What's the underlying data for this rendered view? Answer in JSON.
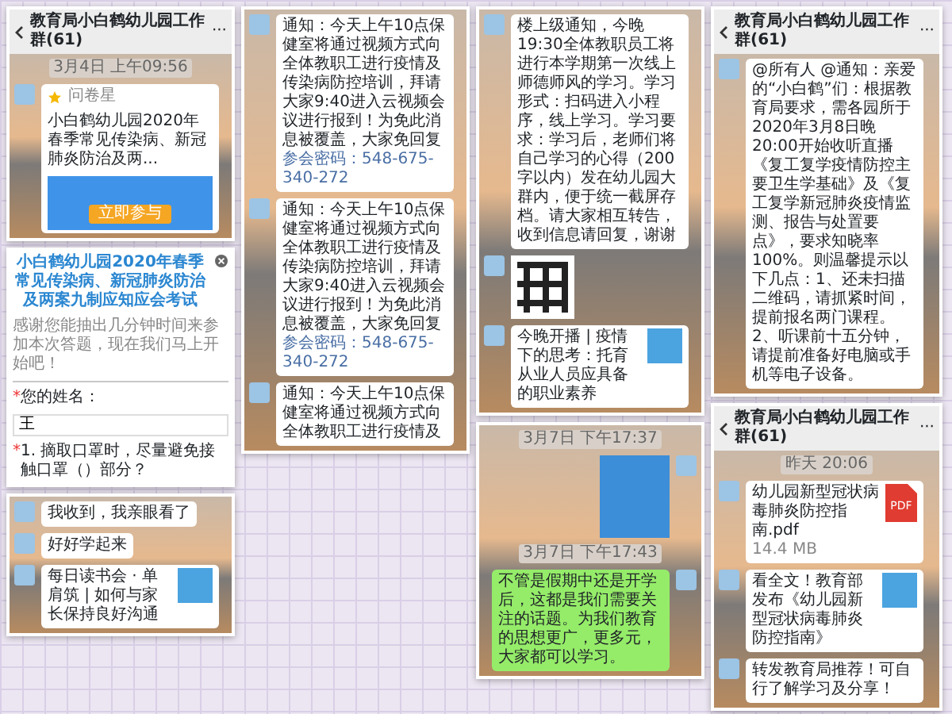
{
  "columns": [
    {
      "screens": [
        {
          "kind": "chat",
          "title": "教育局小白鹤幼儿园工作群(61)",
          "menu": "···",
          "messages": [
            {
              "kind": "time",
              "text": "3月4日 上午09:56"
            },
            {
              "kind": "share",
              "mine": false,
              "source": "问卷星",
              "title": "小白鹤幼儿园2020年春季常见传染病、新冠肺炎防治及两...",
              "button": "立即参与"
            }
          ]
        },
        {
          "kind": "form",
          "title": "小白鹤幼儿园2020年春季常见传染病、新冠肺炎防治及两案九制应知应会考试",
          "intro": "感谢您能抽出几分钟时间来参加本次答题，现在我们马上开始吧！",
          "mark": "*",
          "label": "您的姓名：",
          "value": "王",
          "question": "1. 摘取口罩时，尽量避免接触口罩（）部分？"
        },
        {
          "kind": "chat",
          "messages": [
            {
              "kind": "text",
              "mine": false,
              "text": "我收到，我亲眼看了"
            },
            {
              "kind": "text",
              "mine": false,
              "text": "好好学起来"
            },
            {
              "kind": "article",
              "mine": false,
              "title": "每日读书会 · 单肩筑 | 如何与家长保持良好沟通"
            }
          ]
        }
      ]
    },
    {
      "screens": [
        {
          "kind": "chat",
          "messages": [
            {
              "kind": "text",
              "mine": false,
              "text": "通知：今天上午10点保健室将通过视频方式向全体教职工进行疫情及传染病防控培训，拜请大家9:40进入云视频会议进行报到！为免此消息被覆盖，大家免回复",
              "extra": "参会密码：548-675-340-272"
            },
            {
              "kind": "text",
              "mine": false,
              "text": "通知：今天上午10点保健室将通过视频方式向全体教职工进行疫情及传染病防控培训，拜请大家9:40进入云视频会议进行报到！为免此消息被覆盖，大家免回复",
              "extra": "参会密码：548-675-340-272"
            },
            {
              "kind": "text",
              "mine": false,
              "text": "通知：今天上午10点保健室将通过视频方式向全体教职工进行疫情及"
            }
          ]
        }
      ]
    },
    {
      "screens": [
        {
          "kind": "chat",
          "messages": [
            {
              "kind": "text",
              "mine": false,
              "text": "楼上级通知，今晚19:30全体教职员工将进行本学期第一次线上师德师风的学习。学习形式：扫码进入小程序，线上学习。学习要求：学习后，老师们将自己学习的心得（200字以内）发在幼儿园大群内，便于统一截屏存档。请大家相互转告，收到信息请回复，谢谢"
            },
            {
              "kind": "qr",
              "mine": false
            },
            {
              "kind": "article",
              "mine": false,
              "title": "今晚开播 | 疫情下的思考：托育从业人员应具备的职业素养"
            }
          ]
        },
        {
          "kind": "chat",
          "messages": [
            {
              "kind": "time",
              "text": "3月7日 下午17:37"
            },
            {
              "kind": "image",
              "mine": true
            },
            {
              "kind": "time",
              "text": "3月7日 下午17:43"
            },
            {
              "kind": "text",
              "mine": true,
              "text": "不管是假期中还是开学后，这都是我们需要关注的话题。为我们教育的思想更广，更多元，大家都可以学习。"
            }
          ]
        }
      ]
    },
    {
      "screens": [
        {
          "kind": "chat",
          "title": "教育局小白鹤幼儿园工作群(61)",
          "menu": "···",
          "messages": [
            {
              "kind": "text",
              "mine": false,
              "text": "@所有人 @通知：亲爱的“小白鹤”们：根据教育局要求，需各园所于2020年3月8日晚20:00开始收听直播《复工复学疫情防控主要卫生学基础》及《复工复学新冠肺炎疫情监测、报告与处置要点》，要求知晓率100%。则温馨提示以下几点：1、还未扫描二维码，请抓紧时间，提前报名两门课程。2、听课前十五分钟，请提前准备好电脑或手机等电子设备。"
            }
          ]
        },
        {
          "kind": "chat",
          "title": "教育局小白鹤幼儿园工作群(61)",
          "menu": "···",
          "messages": [
            {
              "kind": "time",
              "text": "昨天 20:06"
            },
            {
              "kind": "file",
              "mine": false,
              "name": "幼儿园新型冠状病毒肺炎防控指南.pdf",
              "size": "14.4 MB",
              "badge": "PDF"
            },
            {
              "kind": "article",
              "mine": false,
              "title": "看全文！教育部发布《幼儿园新型冠状病毒肺炎防控指南》"
            },
            {
              "kind": "text",
              "mine": false,
              "text": "转发教育局推荐！可自行了解学习及分享！"
            }
          ]
        }
      ]
    }
  ]
}
